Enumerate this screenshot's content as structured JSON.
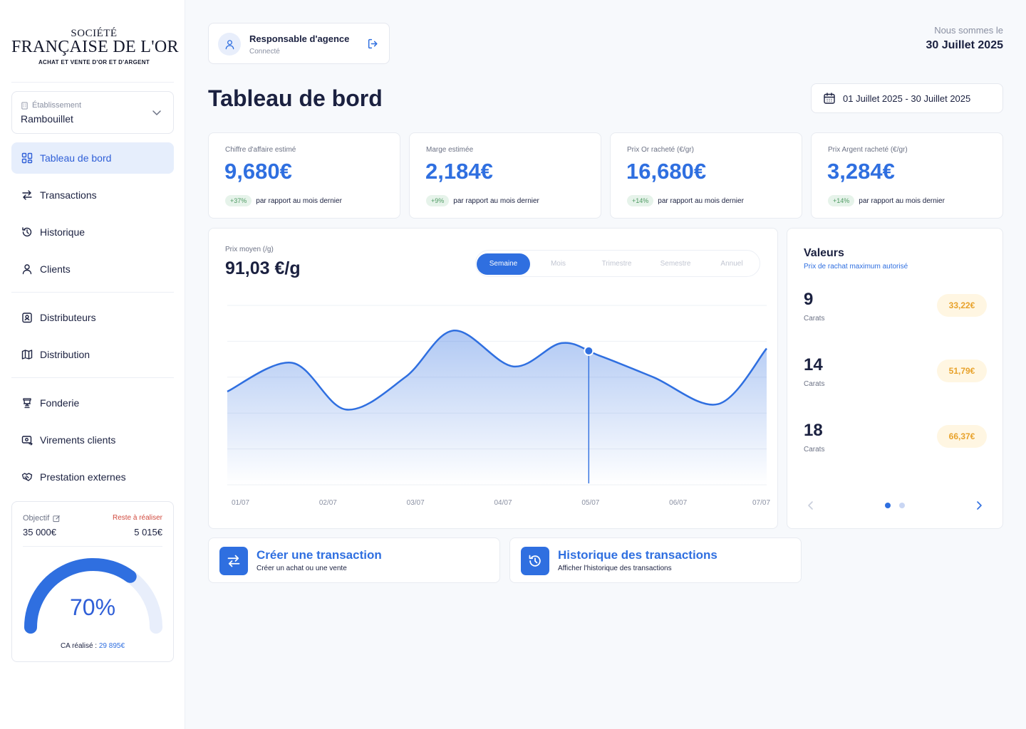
{
  "brand": {
    "line1": "SOCIÉTÉ",
    "line2": "FRANÇAISE DE L'OR",
    "tagline": "ACHAT ET VENTE D'OR ET D'ARGENT"
  },
  "establishment": {
    "label": "Établissement",
    "value": "Rambouillet"
  },
  "nav": [
    {
      "label": "Tableau de bord",
      "icon": "dashboard-icon",
      "active": true
    },
    {
      "label": "Transactions",
      "icon": "swap-icon"
    },
    {
      "label": "Historique",
      "icon": "history-icon"
    },
    {
      "label": "Clients",
      "icon": "user-icon"
    },
    {
      "label": "Distributeurs",
      "icon": "badge-icon"
    },
    {
      "label": "Distribution",
      "icon": "map-icon"
    },
    {
      "label": "Fonderie",
      "icon": "trophy-icon"
    },
    {
      "label": "Virements clients",
      "icon": "transfer-icon"
    },
    {
      "label": "Prestation externes",
      "icon": "handshake-icon"
    }
  ],
  "objective": {
    "label": "Objectif",
    "value": "35 000€",
    "remaining_label": "Reste à réaliser",
    "remaining_value": "5 015€",
    "percent_text": "70%",
    "percent": 0.7,
    "ca_label": "CA réalisé :",
    "ca_value": "29 895€"
  },
  "user": {
    "role": "Responsable d'agence",
    "status": "Connecté"
  },
  "today": {
    "label": "Nous sommes le",
    "date": "30 Juillet 2025"
  },
  "page_title": "Tableau de bord",
  "date_range": "01 Juillet 2025 - 30 Juillet 2025",
  "kpis": [
    {
      "label": "Chiffre d'affaire estimé",
      "value": "9,680€",
      "delta": "+37%",
      "compare": "par rapport au mois dernier"
    },
    {
      "label": "Marge estimée",
      "value": "2,184€",
      "delta": "+9%",
      "compare": "par rapport au mois dernier"
    },
    {
      "label": "Prix Or racheté (€/gr)",
      "value": "16,680€",
      "delta": "+14%",
      "compare": "par rapport au mois dernier"
    },
    {
      "label": "Prix Argent racheté (€/gr)",
      "value": "3,284€",
      "delta": "+14%",
      "compare": "par rapport au mois dernier"
    }
  ],
  "chart_panel": {
    "label": "Prix moyen (/g)",
    "value": "91,03 €/g",
    "periods": [
      "Semaine",
      "Mois",
      "Trimestre",
      "Semestre",
      "Annuel"
    ],
    "active_period": "Semaine"
  },
  "chart_data": {
    "type": "area",
    "categories": [
      "01/07",
      "02/07",
      "03/07",
      "04/07",
      "05/07",
      "06/07",
      "07/07"
    ],
    "series": [
      {
        "values": [
          0.52,
          0.68,
          0.42,
          0.6,
          0.86,
          0.66,
          0.79,
          0.72,
          0.6,
          0.45,
          0.76
        ]
      }
    ],
    "x_positions": [
      0,
      0.12,
      0.22,
      0.33,
      0.42,
      0.53,
      0.62,
      0.69,
      0.79,
      0.91,
      1.0
    ],
    "highlight_category": "05/07",
    "grid": true,
    "accent": "#2f6fe0"
  },
  "values_panel": {
    "title": "Valeurs",
    "subtitle": "Prix de rachat maximum autorisé",
    "items": [
      {
        "carat": "9",
        "unit": "Carats",
        "price": "33,22€"
      },
      {
        "carat": "14",
        "unit": "Carats",
        "price": "51,79€"
      },
      {
        "carat": "18",
        "unit": "Carats",
        "price": "66,37€"
      }
    ],
    "page": 1,
    "pages": 2
  },
  "actions": [
    {
      "title": "Créer une transaction",
      "subtitle": "Créer un achat ou une vente",
      "icon": "swap-icon"
    },
    {
      "title": "Historique des transactions",
      "subtitle": "Afficher l'historique des transactions",
      "icon": "history-icon"
    }
  ],
  "colors": {
    "accent": "#2f6fe0",
    "accent_light": "#e6eefc",
    "warning": "#e8a22b",
    "danger": "#d14a3e",
    "success": "#4f9b63"
  }
}
